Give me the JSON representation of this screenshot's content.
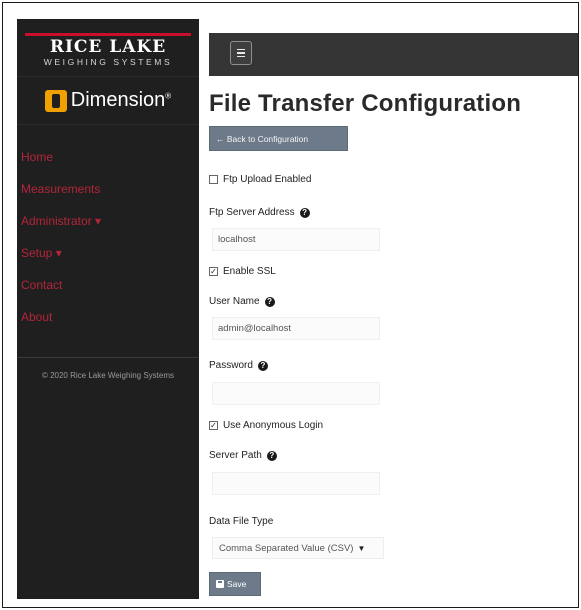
{
  "brand": {
    "company": "RICE LAKE",
    "tagline": "WEIGHING SYSTEMS",
    "product": "Dimension",
    "product_mark": "®"
  },
  "sidebar": {
    "items": [
      {
        "label": "Home"
      },
      {
        "label": "Measurements"
      },
      {
        "label": "Administrator ▾"
      },
      {
        "label": "Setup ▾"
      },
      {
        "label": "Contact"
      },
      {
        "label": "About"
      }
    ],
    "copyright": "© 2020 Rice Lake Weighing Systems"
  },
  "topbar": {
    "menu_icon": "hamburger-icon"
  },
  "page": {
    "title": "File Transfer Configuration",
    "back_label": "← Back to Configuration"
  },
  "form": {
    "ftp_upload_enabled": {
      "label": "Ftp Upload Enabled",
      "checked": false
    },
    "ftp_server_address": {
      "label": "Ftp Server Address",
      "value": "localhost"
    },
    "enable_ssl": {
      "label": "Enable SSL",
      "checked": true
    },
    "user_name": {
      "label": "User Name",
      "value": "admin@localhost"
    },
    "password": {
      "label": "Password",
      "value": ""
    },
    "use_anonymous_login": {
      "label": "Use Anonymous Login",
      "checked": true
    },
    "server_path": {
      "label": "Server Path",
      "value": ""
    },
    "data_file_type": {
      "label": "Data File Type",
      "selected": "Comma Separated Value (CSV)"
    },
    "save_label": "Save"
  },
  "colors": {
    "sidebar_bg": "#1f1f1f",
    "nav_link": "#b3253a",
    "topbar_bg": "#353535",
    "button_bg": "#6c7a89",
    "brand_red": "#c8102e",
    "brand_orange": "#f0a000"
  }
}
